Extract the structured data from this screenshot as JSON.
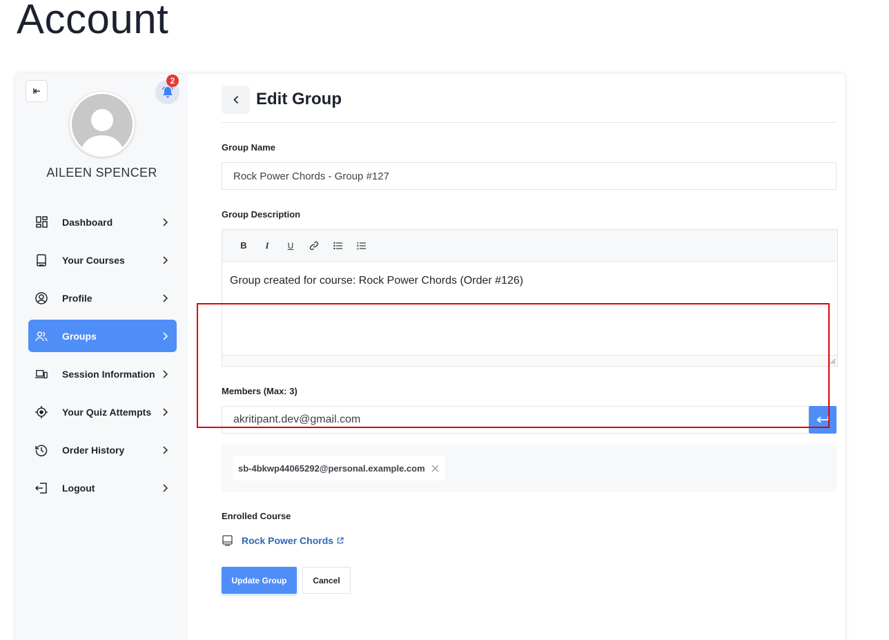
{
  "page": {
    "title": "Account"
  },
  "colors": {
    "accent": "#4f8ef7",
    "badge": "#e53935",
    "highlight": "#e00000",
    "link": "#2f66b3"
  },
  "sidebar": {
    "collapse_icon": "collapse-left-icon",
    "notification_count": "2",
    "user_name": "AILEEN SPENCER",
    "items": [
      {
        "label": "Dashboard",
        "icon": "dashboard-icon",
        "active": false
      },
      {
        "label": "Your Courses",
        "icon": "book-icon",
        "active": false
      },
      {
        "label": "Profile",
        "icon": "user-circle-icon",
        "active": false
      },
      {
        "label": "Groups",
        "icon": "users-icon",
        "active": true
      },
      {
        "label": "Session Information",
        "icon": "devices-icon",
        "active": false
      },
      {
        "label": "Your Quiz Attempts",
        "icon": "target-icon",
        "active": false
      },
      {
        "label": "Order History",
        "icon": "history-icon",
        "active": false
      },
      {
        "label": "Logout",
        "icon": "logout-icon",
        "active": false
      }
    ]
  },
  "form": {
    "heading": "Edit Group",
    "group_name_label": "Group Name",
    "group_name_value": "Rock Power Chords - Group #127",
    "description_label": "Group Description",
    "toolbar": [
      "B",
      "I",
      "U",
      "link",
      "bullet-list",
      "numbered-list"
    ],
    "description_value": "Group created for course: Rock Power Chords (Order #126)",
    "members_label": "Members (Max: 3)",
    "members_input_value": "akritipant.dev@gmail.com",
    "member_tags": [
      "sb-4bkwp44065292@personal.example.com"
    ],
    "enrolled_label": "Enrolled Course",
    "enrolled_course": "Rock Power Chords",
    "update_label": "Update Group",
    "cancel_label": "Cancel"
  }
}
